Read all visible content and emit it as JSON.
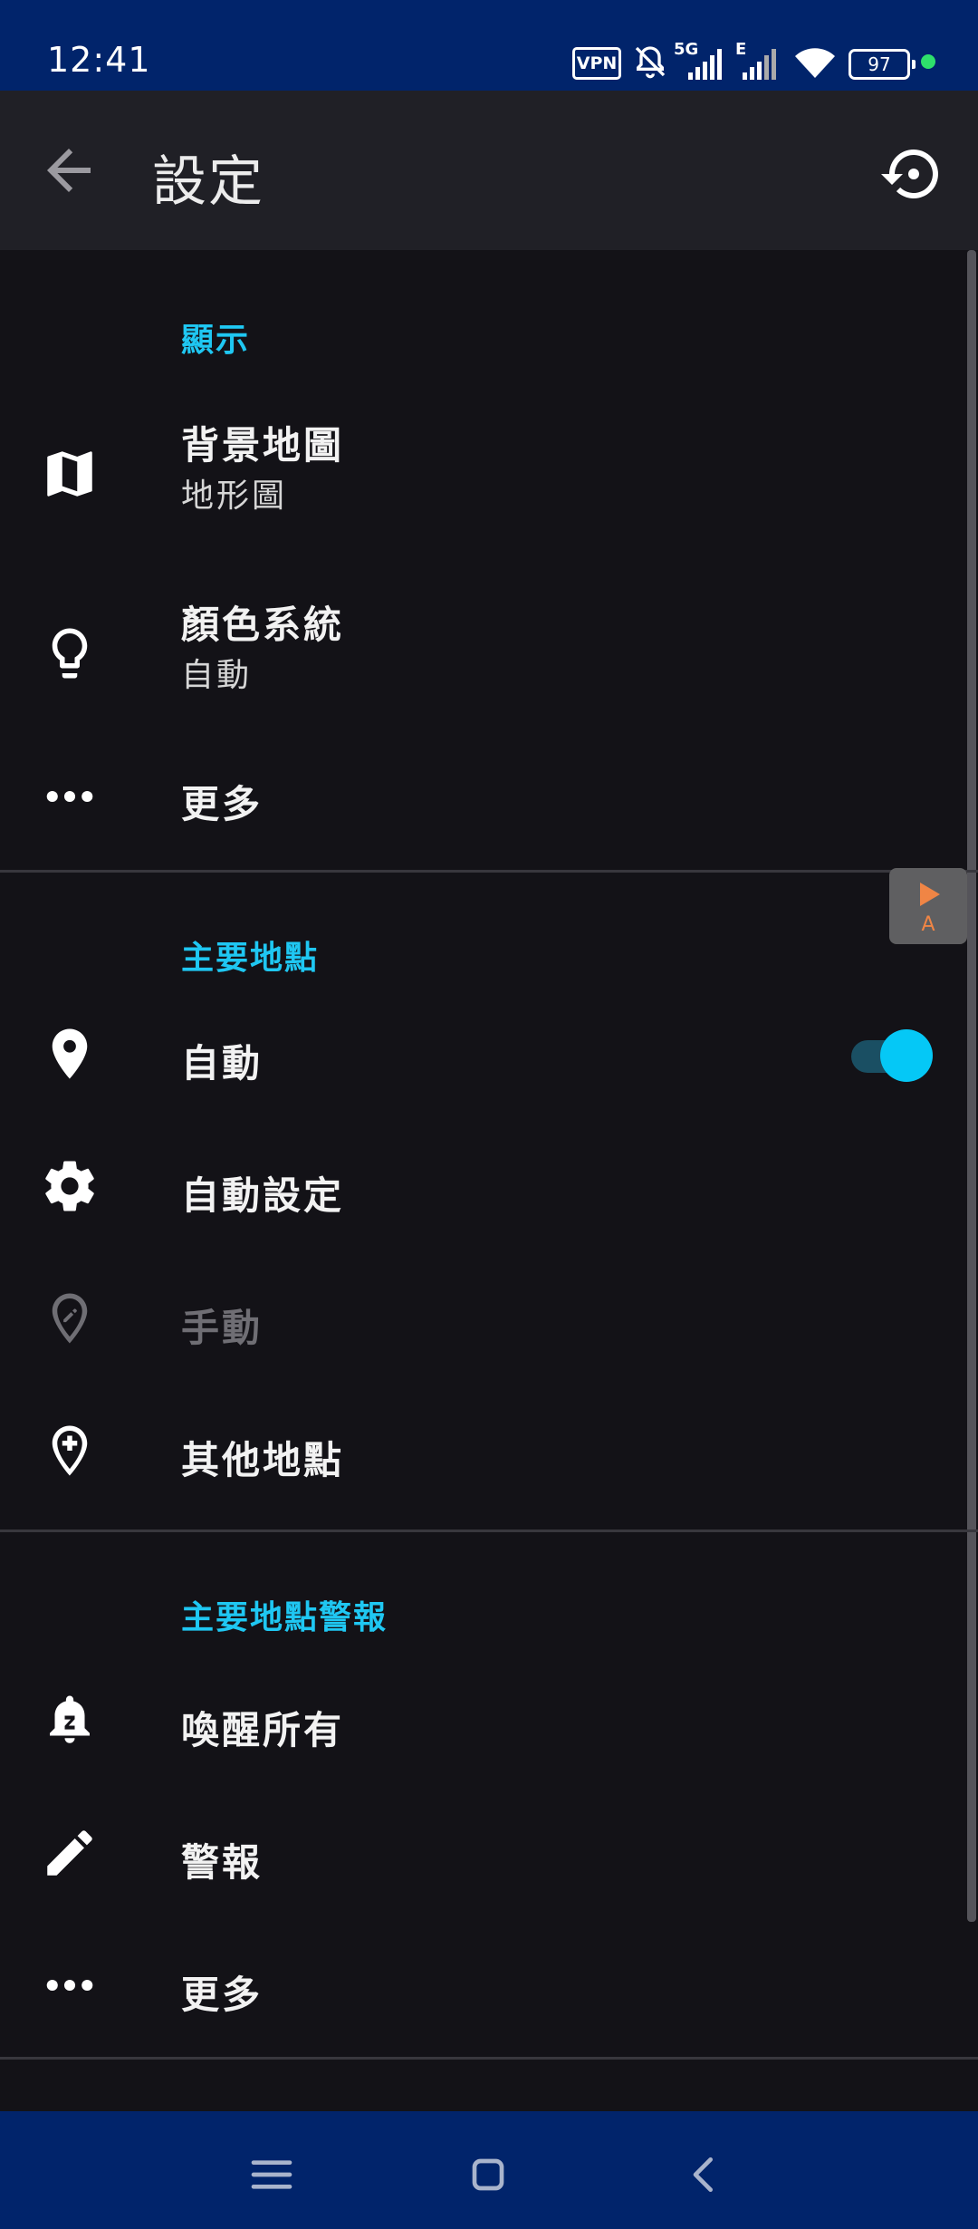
{
  "status_bar": {
    "time": "12:41",
    "vpn": "VPN",
    "network_label": "5G",
    "network2_label": "E",
    "battery": "97"
  },
  "app_bar": {
    "title": "設定",
    "back_icon": "arrow-back-icon",
    "restore_icon": "restore-icon"
  },
  "sections": {
    "display": {
      "header": "顯示",
      "background_map": {
        "title": "背景地圖",
        "value": "地形圖",
        "icon": "map-icon"
      },
      "color_system": {
        "title": "顏色系統",
        "value": "自動",
        "icon": "lightbulb-icon"
      },
      "more": {
        "title": "更多",
        "icon": "more-horiz-icon"
      }
    },
    "main_location": {
      "header": "主要地點",
      "auto": {
        "title": "自動",
        "icon": "location-pin-icon",
        "enabled": true
      },
      "auto_settings": {
        "title": "自動設定",
        "icon": "gear-icon"
      },
      "manual": {
        "title": "手動",
        "icon": "location-edit-icon",
        "disabled": true
      },
      "other_locations": {
        "title": "其他地點",
        "icon": "location-add-icon"
      }
    },
    "alerts": {
      "header": "主要地點警報",
      "wake_all": {
        "title": "喚醒所有",
        "icon": "snooze-bell-icon"
      },
      "alerts": {
        "title": "警報",
        "icon": "pencil-icon"
      },
      "more": {
        "title": "更多",
        "icon": "more-horiz-icon"
      }
    }
  },
  "floating_widget": {
    "label": "A",
    "icon": "play-icon"
  },
  "nav_bar": {
    "menu_icon": "menu-icon",
    "home_icon": "home-icon",
    "back_icon": "back-chevron-icon"
  },
  "colors": {
    "accent": "#1fc7f2",
    "background": "#131217",
    "app_bar": "#202026",
    "system_bar": "#01246b",
    "toggle_thumb": "#05c8f6"
  }
}
